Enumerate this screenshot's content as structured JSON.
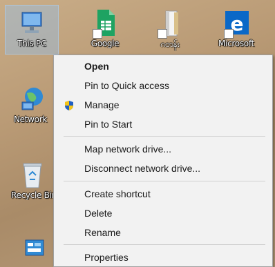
{
  "desktop": {
    "icons": [
      {
        "label": "This PC",
        "icon": "computer-icon"
      },
      {
        "label": "Google",
        "icon": "google-sheets-icon"
      },
      {
        "label": "ဂ၀ာန်း",
        "icon": "folder-shortcut-icon"
      },
      {
        "label": "Microsoft",
        "icon": "microsoft-edge-icon"
      },
      {
        "label": "Network",
        "icon": "network-globe-icon"
      },
      {
        "label": "Recycle Bin",
        "icon": "recycle-bin-icon"
      },
      {
        "label": "",
        "icon": "control-panel-icon"
      }
    ]
  },
  "context_menu": {
    "items": [
      {
        "label": "Open",
        "bold": true
      },
      {
        "label": "Pin to Quick access"
      },
      {
        "label": "Manage",
        "icon": "shield-icon"
      },
      {
        "label": "Pin to Start"
      },
      {
        "label": "Map network drive..."
      },
      {
        "label": "Disconnect network drive..."
      },
      {
        "label": "Create shortcut"
      },
      {
        "label": "Delete"
      },
      {
        "label": "Rename"
      },
      {
        "label": "Properties"
      }
    ]
  },
  "colors": {
    "menu_bg": "#f2f2f2",
    "selection": "#96bee6",
    "shield_blue": "#1f5fc4",
    "shield_yellow": "#f5c518",
    "edge_blue": "#0a68c7",
    "sheets_green": "#1ea362"
  }
}
